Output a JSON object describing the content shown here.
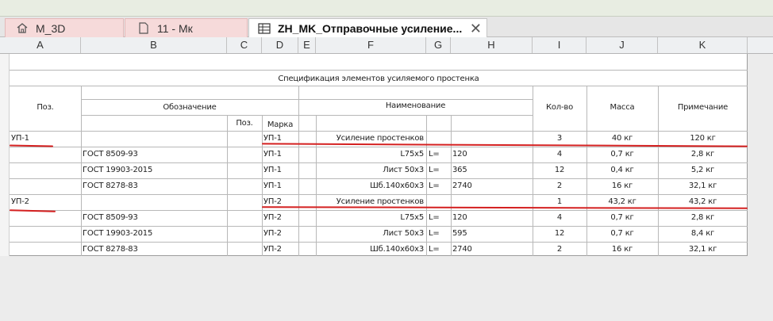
{
  "tabs": [
    {
      "label": "M_3D",
      "icon": "home-icon"
    },
    {
      "label": "11 - Мк",
      "icon": "sheet-icon"
    },
    {
      "label": "ZH_MK_Отправочные усиление...",
      "icon": "table-icon",
      "active": true
    }
  ],
  "close_glyph": "✕",
  "columns": [
    "A",
    "B",
    "C",
    "D",
    "E",
    "F",
    "G",
    "H",
    "I",
    "J",
    "K"
  ],
  "schedule": {
    "title": "Спецификация элементов усиляемого простенка",
    "headers": {
      "pos": "Поз.",
      "designation": "Обозначение",
      "name": "Наименование",
      "qty": "Кол-во",
      "mass": "Масса",
      "note": "Примечание",
      "pos_sub": "Поз.",
      "mark_sub": "Марка"
    },
    "rows": [
      {
        "pos": "УП-1",
        "gost": "",
        "mark": "УП-1",
        "name": "Усиление простенков",
        "l": "",
        "len": "",
        "qty": "3",
        "mass": "40 кг",
        "note": "120 кг"
      },
      {
        "pos": "",
        "gost": "ГОСТ 8509-93",
        "mark": "УП-1",
        "name": "L75х5",
        "l": "L=",
        "len": "120",
        "qty": "4",
        "mass": "0,7 кг",
        "note": "2,8 кг"
      },
      {
        "pos": "",
        "gost": "ГОСТ 19903-2015",
        "mark": "УП-1",
        "name": "Лист 50х3",
        "l": "L=",
        "len": "365",
        "qty": "12",
        "mass": "0,4 кг",
        "note": "5,2 кг"
      },
      {
        "pos": "",
        "gost": "ГОСТ 8278-83",
        "mark": "УП-1",
        "name": "Шб.140х60х3",
        "l": "L=",
        "len": "2740",
        "qty": "2",
        "mass": "16 кг",
        "note": "32,1 кг"
      },
      {
        "pos": "УП-2",
        "gost": "",
        "mark": "УП-2",
        "name": "Усиление простенков",
        "l": "",
        "len": "",
        "qty": "1",
        "mass": "43,2 кг",
        "note": "43,2 кг"
      },
      {
        "pos": "",
        "gost": "ГОСТ 8509-93",
        "mark": "УП-2",
        "name": "L75х5",
        "l": "L=",
        "len": "120",
        "qty": "4",
        "mass": "0,7 кг",
        "note": "2,8 кг"
      },
      {
        "pos": "",
        "gost": "ГОСТ 19903-2015",
        "mark": "УП-2",
        "name": "Лист 50х3",
        "l": "L=",
        "len": "595",
        "qty": "12",
        "mass": "0,7 кг",
        "note": "8,4 кг"
      },
      {
        "pos": "",
        "gost": "ГОСТ 8278-83",
        "mark": "УП-2",
        "name": "Шб.140х60х3",
        "l": "L=",
        "len": "2740",
        "qty": "2",
        "mass": "16 кг",
        "note": "32,1 кг"
      }
    ]
  },
  "colors": {
    "annotation": "#d42020",
    "tab_inactive": "#f6dada"
  }
}
